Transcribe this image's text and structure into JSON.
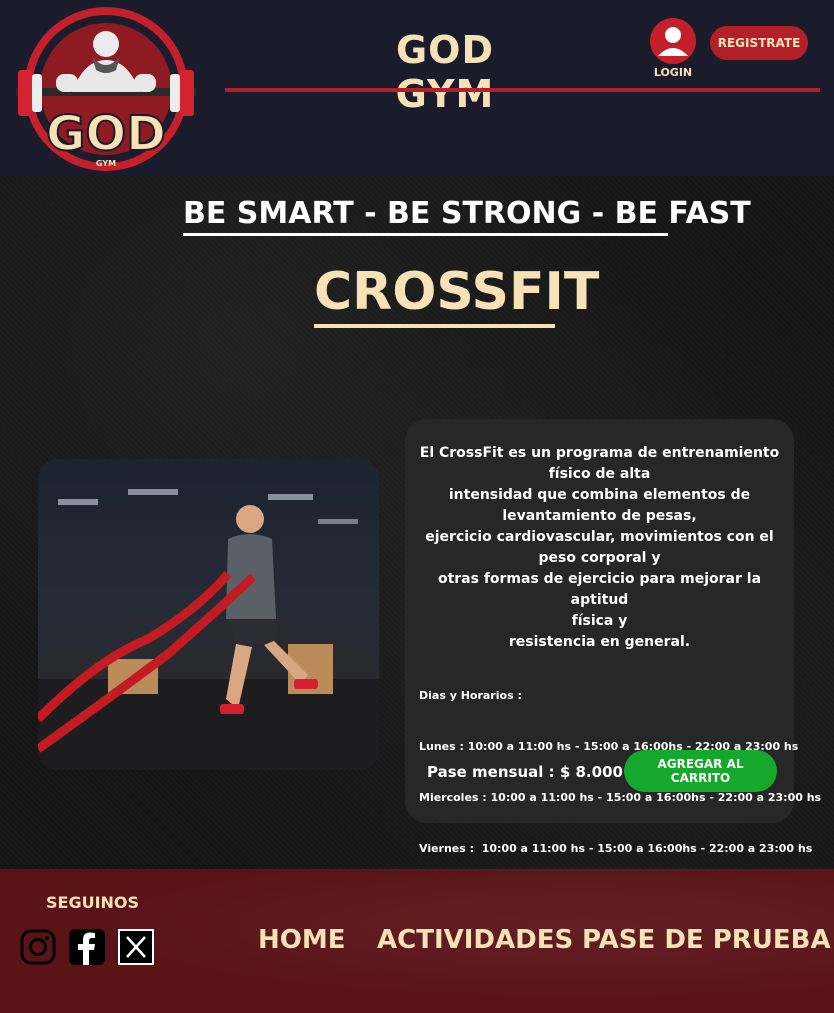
{
  "header": {
    "site_title": "GOD GYM",
    "logo_text": "GOD",
    "logo_subtext": "GYM",
    "login_label": "LOGIN",
    "register_label": "REGISTRATE"
  },
  "main": {
    "slogan": "BE SMART - BE STRONG - BE FAST",
    "page_title": "CROSSFIT",
    "description_lines": [
      "El CrossFit es un programa de entrenamiento",
      "físico de alta",
      "intensidad que combina elementos de",
      "levantamiento de pesas,",
      "ejercicio cardiovascular, movimientos con el",
      "peso corporal y",
      "otras formas de ejercicio para mejorar la aptitud",
      "física y",
      "resistencia en general."
    ],
    "schedule_title": "Dias y Horarios :",
    "schedule": [
      "Lunes : 10:00 a 11:00 hs - 15:00 a 16:00hs - 22:00 a 23:00 hs",
      "Miercoles : 10:00 a 11:00 hs - 15:00 a 16:00hs - 22:00 a 23:00 hs",
      "Viernes :  10:00 a 11:00 hs - 15:00 a 16:00hs - 22:00 a 23:00 hs"
    ],
    "price": "Pase mensual : $ 8.000",
    "cart_button": "AGREGAR AL CARRITO"
  },
  "footer": {
    "follow_label": "SEGUINOS",
    "social_icons": [
      "instagram-icon",
      "facebook-icon",
      "x-icon"
    ],
    "nav": [
      "HOME",
      "ACTIVIDADES",
      "PASE DE PRUEBA"
    ]
  },
  "colors": {
    "header_bg": "#1a1b2b",
    "accent_red": "#b3202a",
    "cream": "#f6e2b6",
    "cart_green": "#15a82c",
    "footer_bg": "#5a1418"
  }
}
